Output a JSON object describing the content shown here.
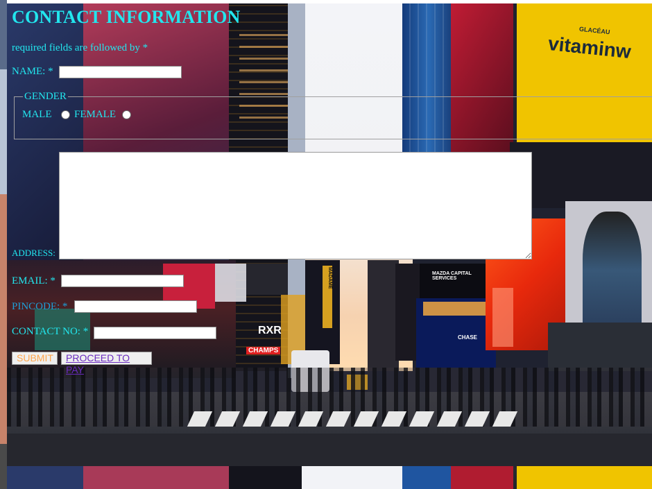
{
  "form": {
    "title": "CONTACT INFORMATION",
    "required_note": "required fields are followed by *",
    "name_label": "NAME: *",
    "gender_legend": "GENDER",
    "male_label": "MALE",
    "female_label": "FEMALE",
    "address_label": "ADDRESS:",
    "email_label": "EMAIL: *",
    "pincode_label": "PINCODE: *",
    "contact_label": "CONTACT NO: *",
    "submit_label": "SUBMIT",
    "pay_label": "PROCEED TO PAY"
  },
  "background": {
    "signs": {
      "vitamin": "vitaminw",
      "glaceau": "GLACÉAU",
      "mazda": "MAZDA CAPITAL SERVICES",
      "rxr": "RXR",
      "champs": "CHAMPS",
      "chase": "CHASE",
      "madame": "MADAME"
    }
  },
  "colors": {
    "label_cyan": "#22e6ee",
    "submit_orange": "#ffa64d",
    "link_purple": "#6a2bbf"
  }
}
